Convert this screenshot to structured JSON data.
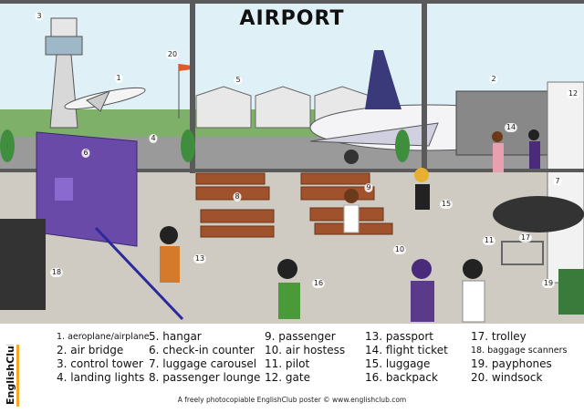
{
  "title": "AIRPORT",
  "scene_labels": [
    "1",
    "2",
    "3",
    "4",
    "5",
    "6",
    "7",
    "8",
    "9",
    "10",
    "11",
    "12",
    "13",
    "14",
    "15",
    "16",
    "17",
    "18",
    "19",
    "20"
  ],
  "legend": [
    [
      "1. aeroplane/airplane",
      "2. air bridge",
      "3. control tower",
      "4. landing lights"
    ],
    [
      "5. hangar",
      "6. check-in counter",
      "7. luggage carousel",
      "8. passenger lounge"
    ],
    [
      "9.  passenger",
      "10. air hostess",
      "11. pilot",
      "12. gate"
    ],
    [
      "13. passport",
      "14. flight ticket",
      "15. luggage",
      "16. backpack"
    ],
    [
      "17. trolley",
      "18. baggage scanners",
      "19. payphones",
      "20. windsock"
    ]
  ],
  "footer": "A freely photocopiable EnglishClub poster © www.englishclub.com",
  "logo_text": "EnglishClub",
  "colors": {
    "sky": "#dff0f7",
    "floor": "#c9c5bd",
    "counter": "#6a4aa8",
    "bench": "#a0522d",
    "logo_accent": "#f5a623"
  }
}
